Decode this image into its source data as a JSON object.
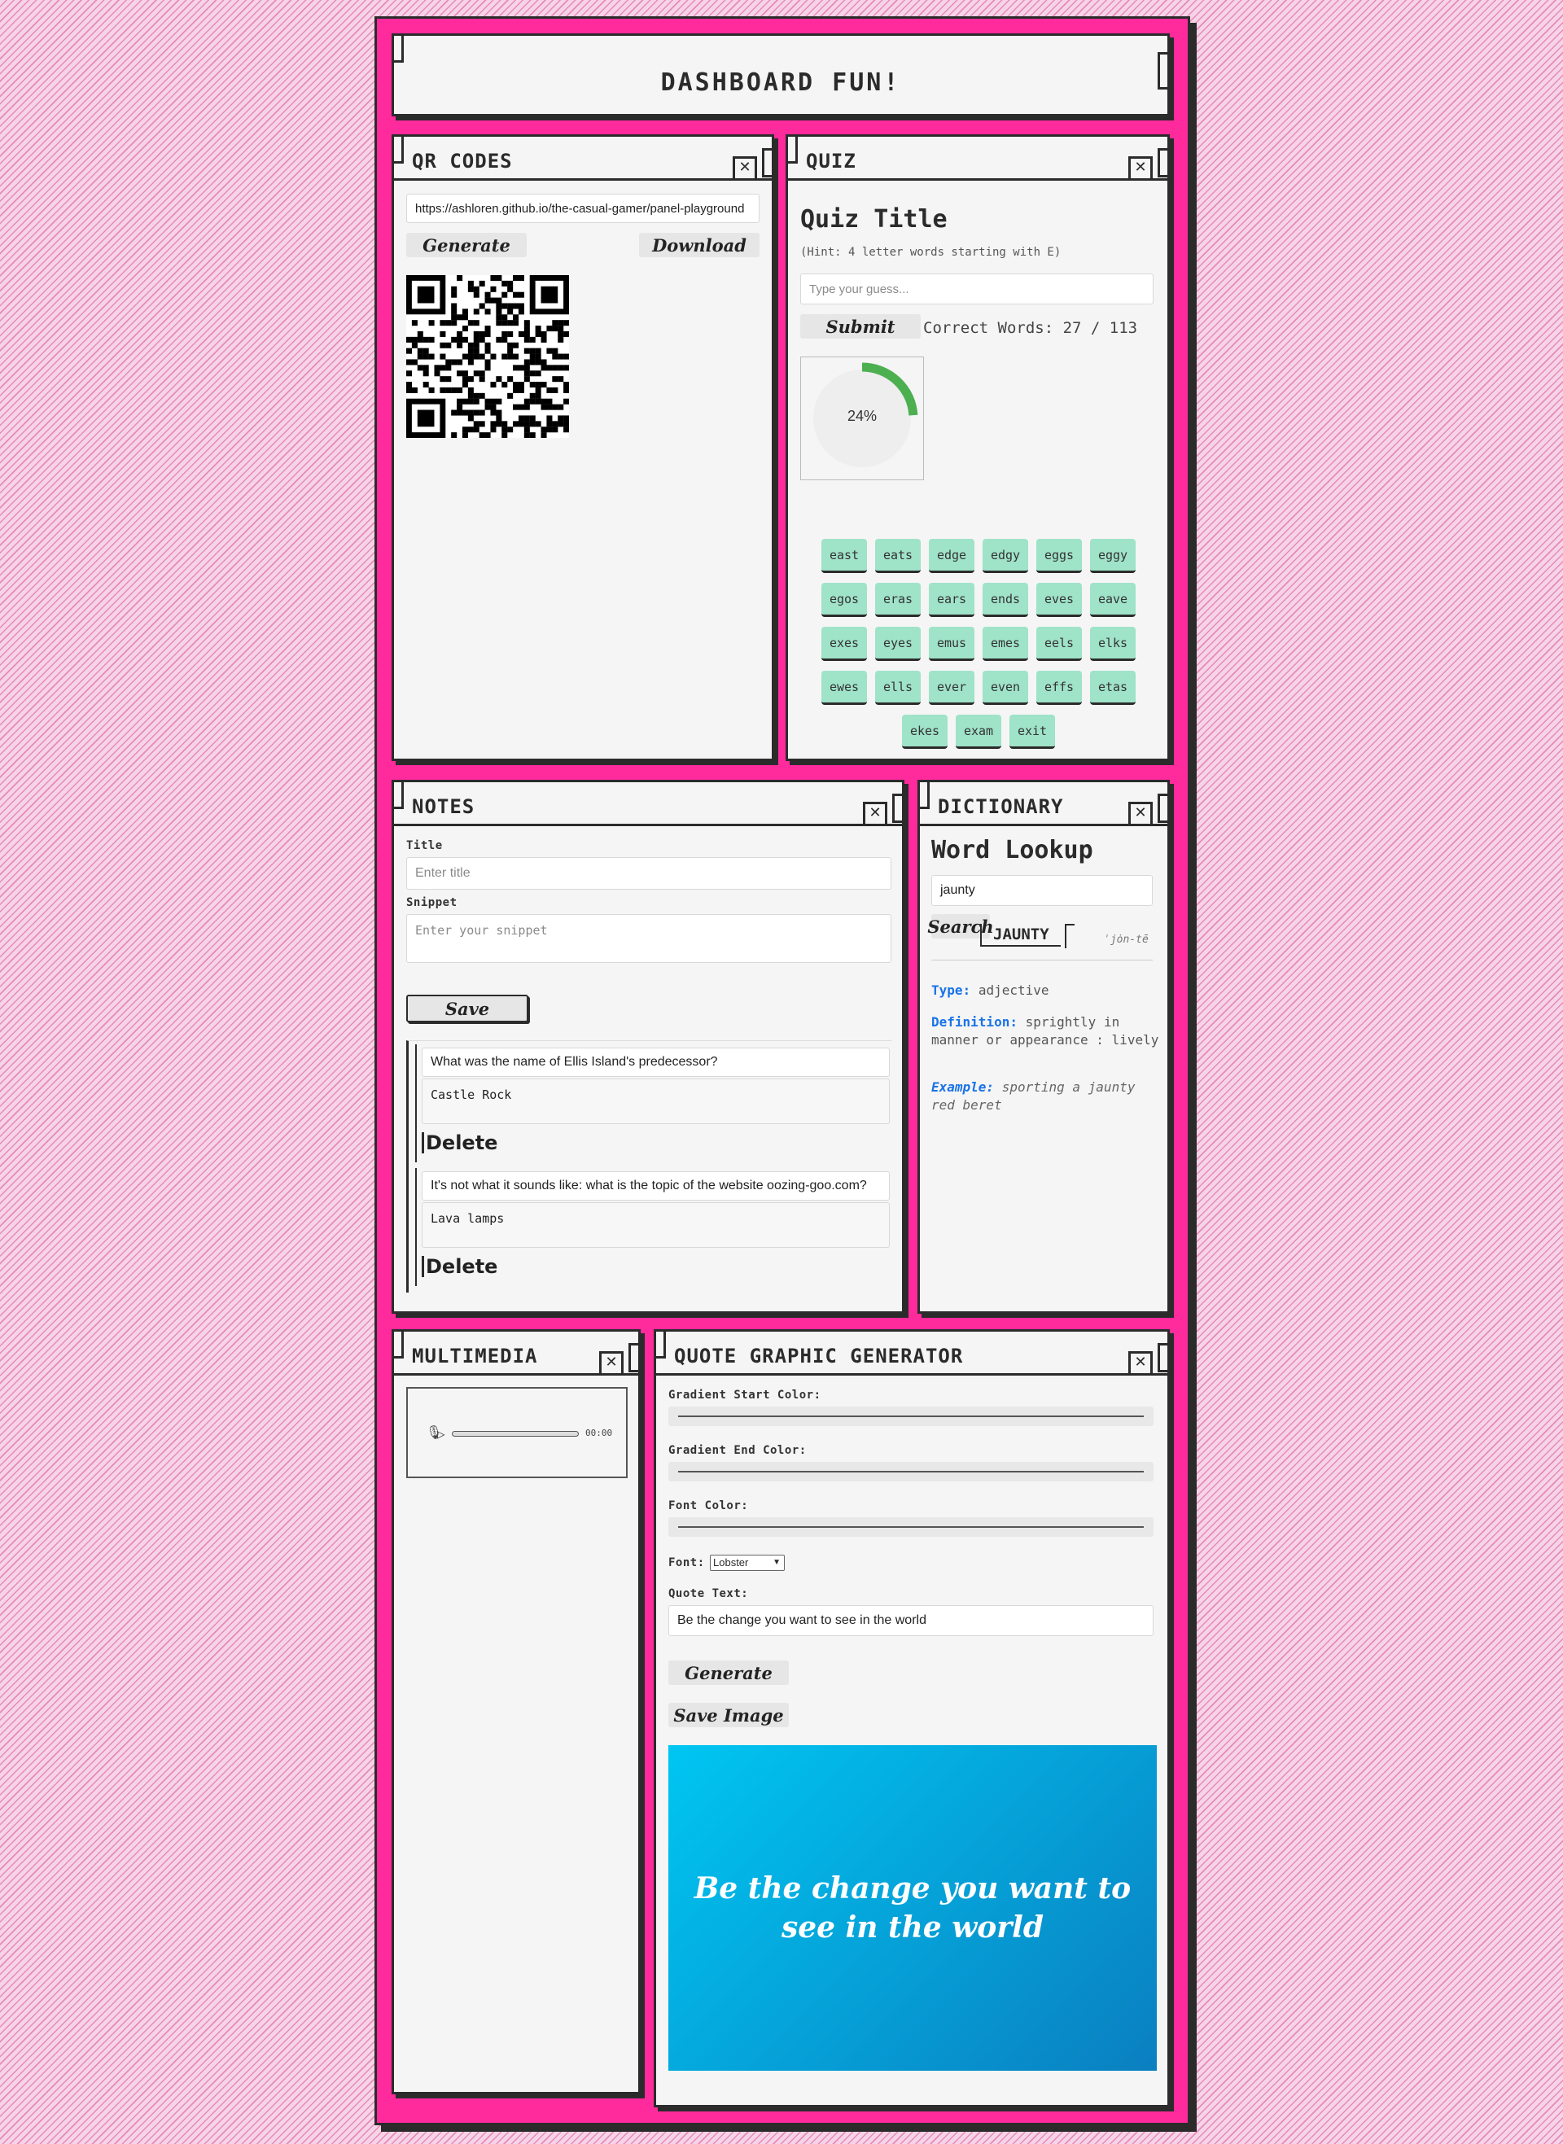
{
  "header": {
    "title": "DASHBOARD FUN!"
  },
  "qr": {
    "title": "QR CODES",
    "url_value": "https://ashloren.github.io/the-casual-gamer/panel-playground",
    "generate_label": "Generate",
    "download_label": "Download"
  },
  "quiz": {
    "title": "QUIZ",
    "heading": "Quiz Title",
    "hint": "(Hint: 4 letter words starting with E)",
    "guess_placeholder": "Type your guess...",
    "submit_label": "Submit",
    "correct_text": "Correct Words: 27 / 113",
    "progress_label": "24%",
    "progress_fraction": 0.24,
    "progress_color": "#4caf50",
    "words": [
      "east",
      "eats",
      "edge",
      "edgy",
      "eggs",
      "eggy",
      "egos",
      "eras",
      "ears",
      "ends",
      "eves",
      "eave",
      "exes",
      "eyes",
      "emus",
      "emes",
      "eels",
      "elks",
      "ewes",
      "ells",
      "ever",
      "even",
      "effs",
      "etas",
      "ekes",
      "exam",
      "exit"
    ]
  },
  "notes": {
    "title": "NOTES",
    "title_label": "Title",
    "title_placeholder": "Enter title",
    "snippet_label": "Snippet",
    "snippet_placeholder": "Enter your snippet",
    "save_label": "Save",
    "items": [
      {
        "title": "What was the name of Ellis Island's predecessor?",
        "snippet": "Castle Rock",
        "delete_label": "Delete"
      },
      {
        "title": "It's not what it sounds like: what is the topic of the website oozing-goo.com?",
        "snippet": "Lava lamps",
        "delete_label": "Delete"
      }
    ]
  },
  "dictionary": {
    "title": "DICTIONARY",
    "heading": "Word Lookup",
    "search_value": "jaunty",
    "search_label": "Search",
    "word": "JAUNTY",
    "pronunciation": "ˈjȯn-tē",
    "type_label": "Type:",
    "type_value": "adjective",
    "definition_label": "Definition:",
    "definition_value": "sprightly in manner or appearance : lively",
    "example_label": "Example:",
    "example_value": "sporting a jaunty red beret",
    "label_color": "#1a73e8"
  },
  "multimedia": {
    "title": "MULTIMEDIA",
    "time": "00:00",
    "mic_icon": "microphone-icon",
    "play_icon": "play-icon"
  },
  "quote": {
    "title": "QUOTE GRAPHIC GENERATOR",
    "start_color_label": "Gradient Start Color:",
    "end_color_label": "Gradient End Color:",
    "font_color_label": "Font Color:",
    "font_label": "Font:",
    "font_selected": "Lobster",
    "quote_label": "Quote Text:",
    "quote_value": "Be the change you want to see in the world",
    "generate_label": "Generate",
    "save_image_label": "Save Image",
    "preview_text": "Be the change you want to see in the world",
    "gradient_start": "#00c6f2",
    "gradient_end": "#0a7fc0",
    "font_color": "#ffffff"
  }
}
